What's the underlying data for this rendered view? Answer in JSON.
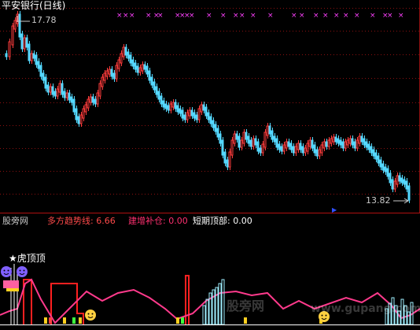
{
  "window": {
    "title": "平安银行(日线)"
  },
  "price_chart": {
    "high_label": "17.78",
    "low_label": "13.82",
    "colors": {
      "up": "#ff3c3c",
      "down": "#54d8ff",
      "grid": "#8b1010",
      "marker": "#ff40ff"
    }
  },
  "indicator_panel": {
    "name": "股旁网",
    "values": [
      {
        "label": "多方趋势线:",
        "value": "6.66",
        "color": "#ff4a4a"
      },
      {
        "label": "建增补仓:",
        "value": "0.00",
        "color": "#ff3070"
      },
      {
        "label": "短期顶部:",
        "value": "0.00",
        "color": "#ffffff"
      }
    ],
    "badge_text": "★虎顶顶"
  },
  "watermark": {
    "brand": "股旁网",
    "url": "www.gupang.com"
  }
}
